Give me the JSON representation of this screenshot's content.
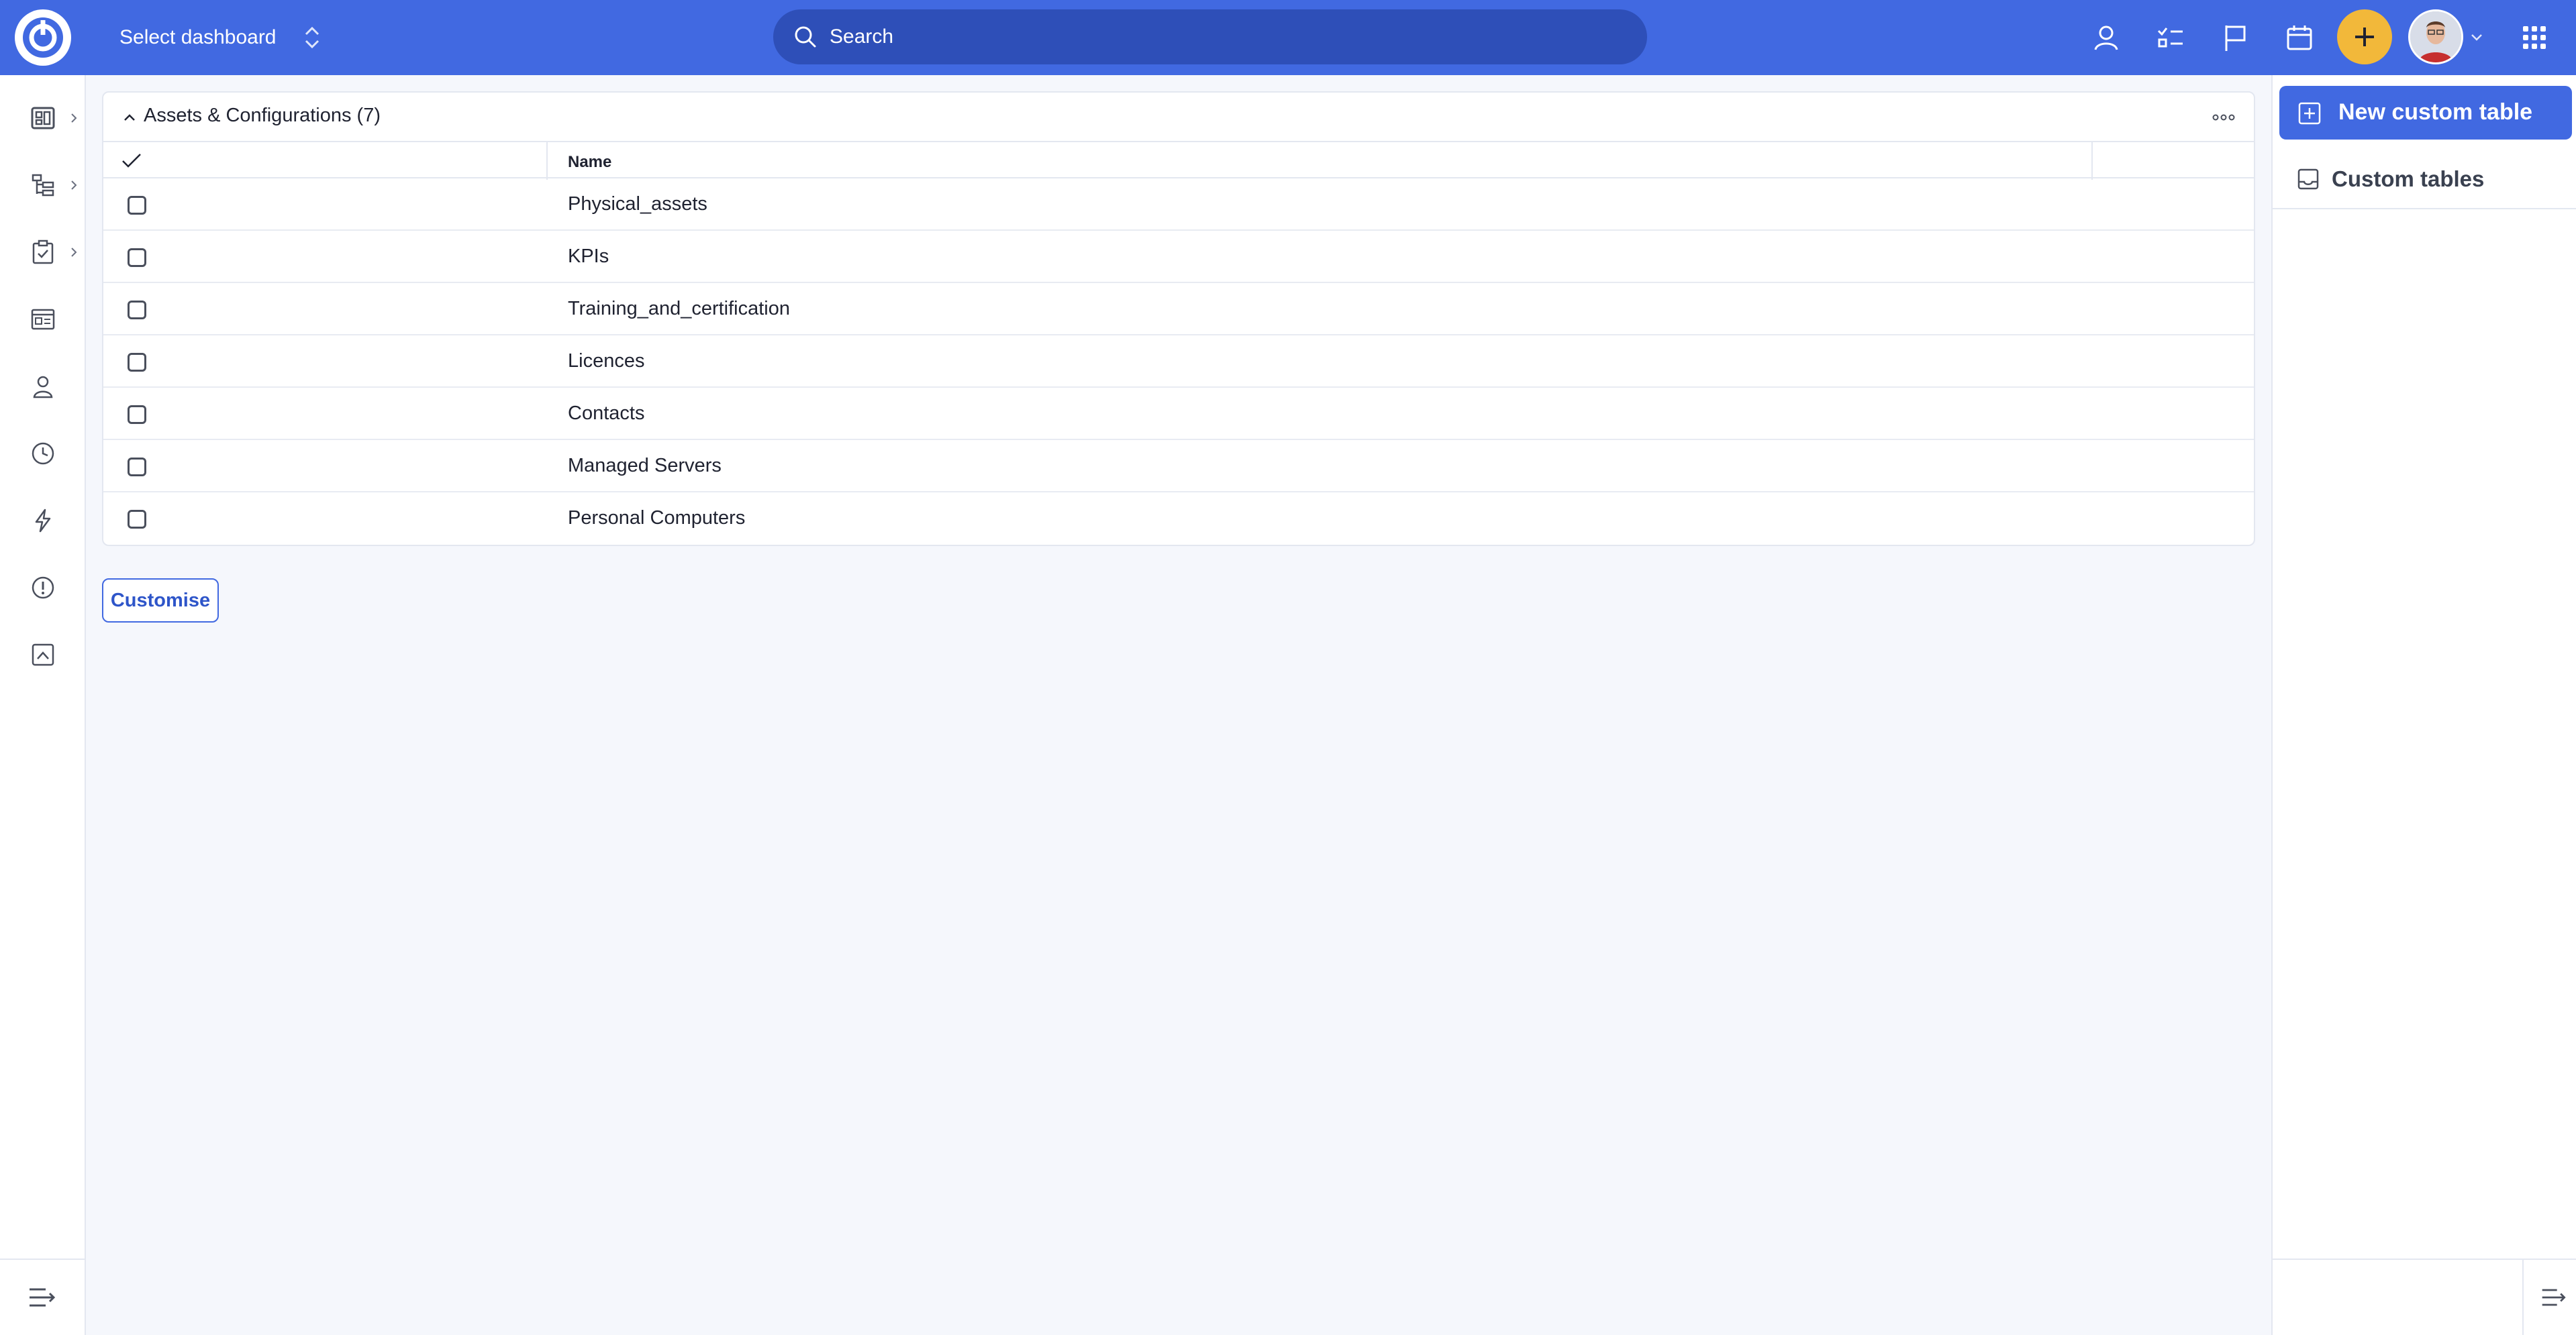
{
  "topbar": {
    "dashboard_select_label": "Select dashboard",
    "search_placeholder": "Search",
    "icons": [
      "user-icon",
      "task-list-icon",
      "flag-icon",
      "calendar-icon",
      "plus-icon",
      "avatar",
      "chevron-down-icon",
      "apps-grid-icon"
    ],
    "accent_color": "#4169e1",
    "plus_color": "#f2b83a"
  },
  "sidebar": {
    "items": [
      {
        "icon": "dashboard-icon",
        "has_submenu": true
      },
      {
        "icon": "projects-tree-icon",
        "has_submenu": true
      },
      {
        "icon": "tasks-clipboard-icon",
        "has_submenu": true
      },
      {
        "icon": "cards-icon",
        "has_submenu": false
      },
      {
        "icon": "user-icon",
        "has_submenu": false
      },
      {
        "icon": "clock-icon",
        "has_submenu": false
      },
      {
        "icon": "lightning-icon",
        "has_submenu": false
      },
      {
        "icon": "alert-icon",
        "has_submenu": false
      },
      {
        "icon": "report-icon",
        "has_submenu": false
      }
    ],
    "collapse_icon": "sidebar-collapse-icon"
  },
  "panel": {
    "title": "Assets & Configurations (7)",
    "columns": [
      "Name"
    ],
    "rows": [
      {
        "name": "Physical_assets"
      },
      {
        "name": "KPIs"
      },
      {
        "name": "Training_and_certification"
      },
      {
        "name": "Licences"
      },
      {
        "name": "Contacts"
      },
      {
        "name": "Managed Servers"
      },
      {
        "name": "Personal Computers"
      }
    ]
  },
  "customise_label": "Customise",
  "rightbar": {
    "new_table_label": "New custom table",
    "custom_tables_label": "Custom tables"
  }
}
